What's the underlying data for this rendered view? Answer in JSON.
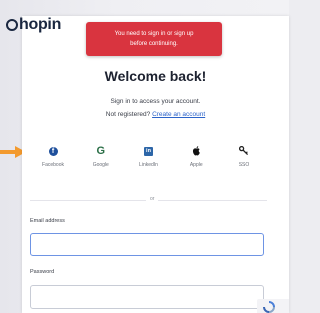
{
  "brand": {
    "logo_text": "hopin"
  },
  "toast": {
    "line1": "You need to sign in or sign up",
    "line2": "before continuing."
  },
  "heading": "Welcome back!",
  "subtitle": {
    "line1": "Sign in to access your account.",
    "prefix": "Not registered?",
    "link": "Create an account"
  },
  "social_logins": [
    {
      "label": "Facebook",
      "icon": "facebook-icon"
    },
    {
      "label": "Google",
      "icon": "google-icon"
    },
    {
      "label": "LinkedIn",
      "icon": "linkedin-icon"
    },
    {
      "label": "Apple",
      "icon": "apple-icon"
    },
    {
      "label": "SSO",
      "icon": "key-icon"
    }
  ],
  "divider_text": "or",
  "form": {
    "email_label": "Email address",
    "email_value": "",
    "password_label": "Password",
    "password_value": ""
  },
  "colors": {
    "toast": "#d9343f",
    "link": "#2b63c9",
    "arrow": "#f39a2e",
    "input_focus": "#6e94e4"
  }
}
